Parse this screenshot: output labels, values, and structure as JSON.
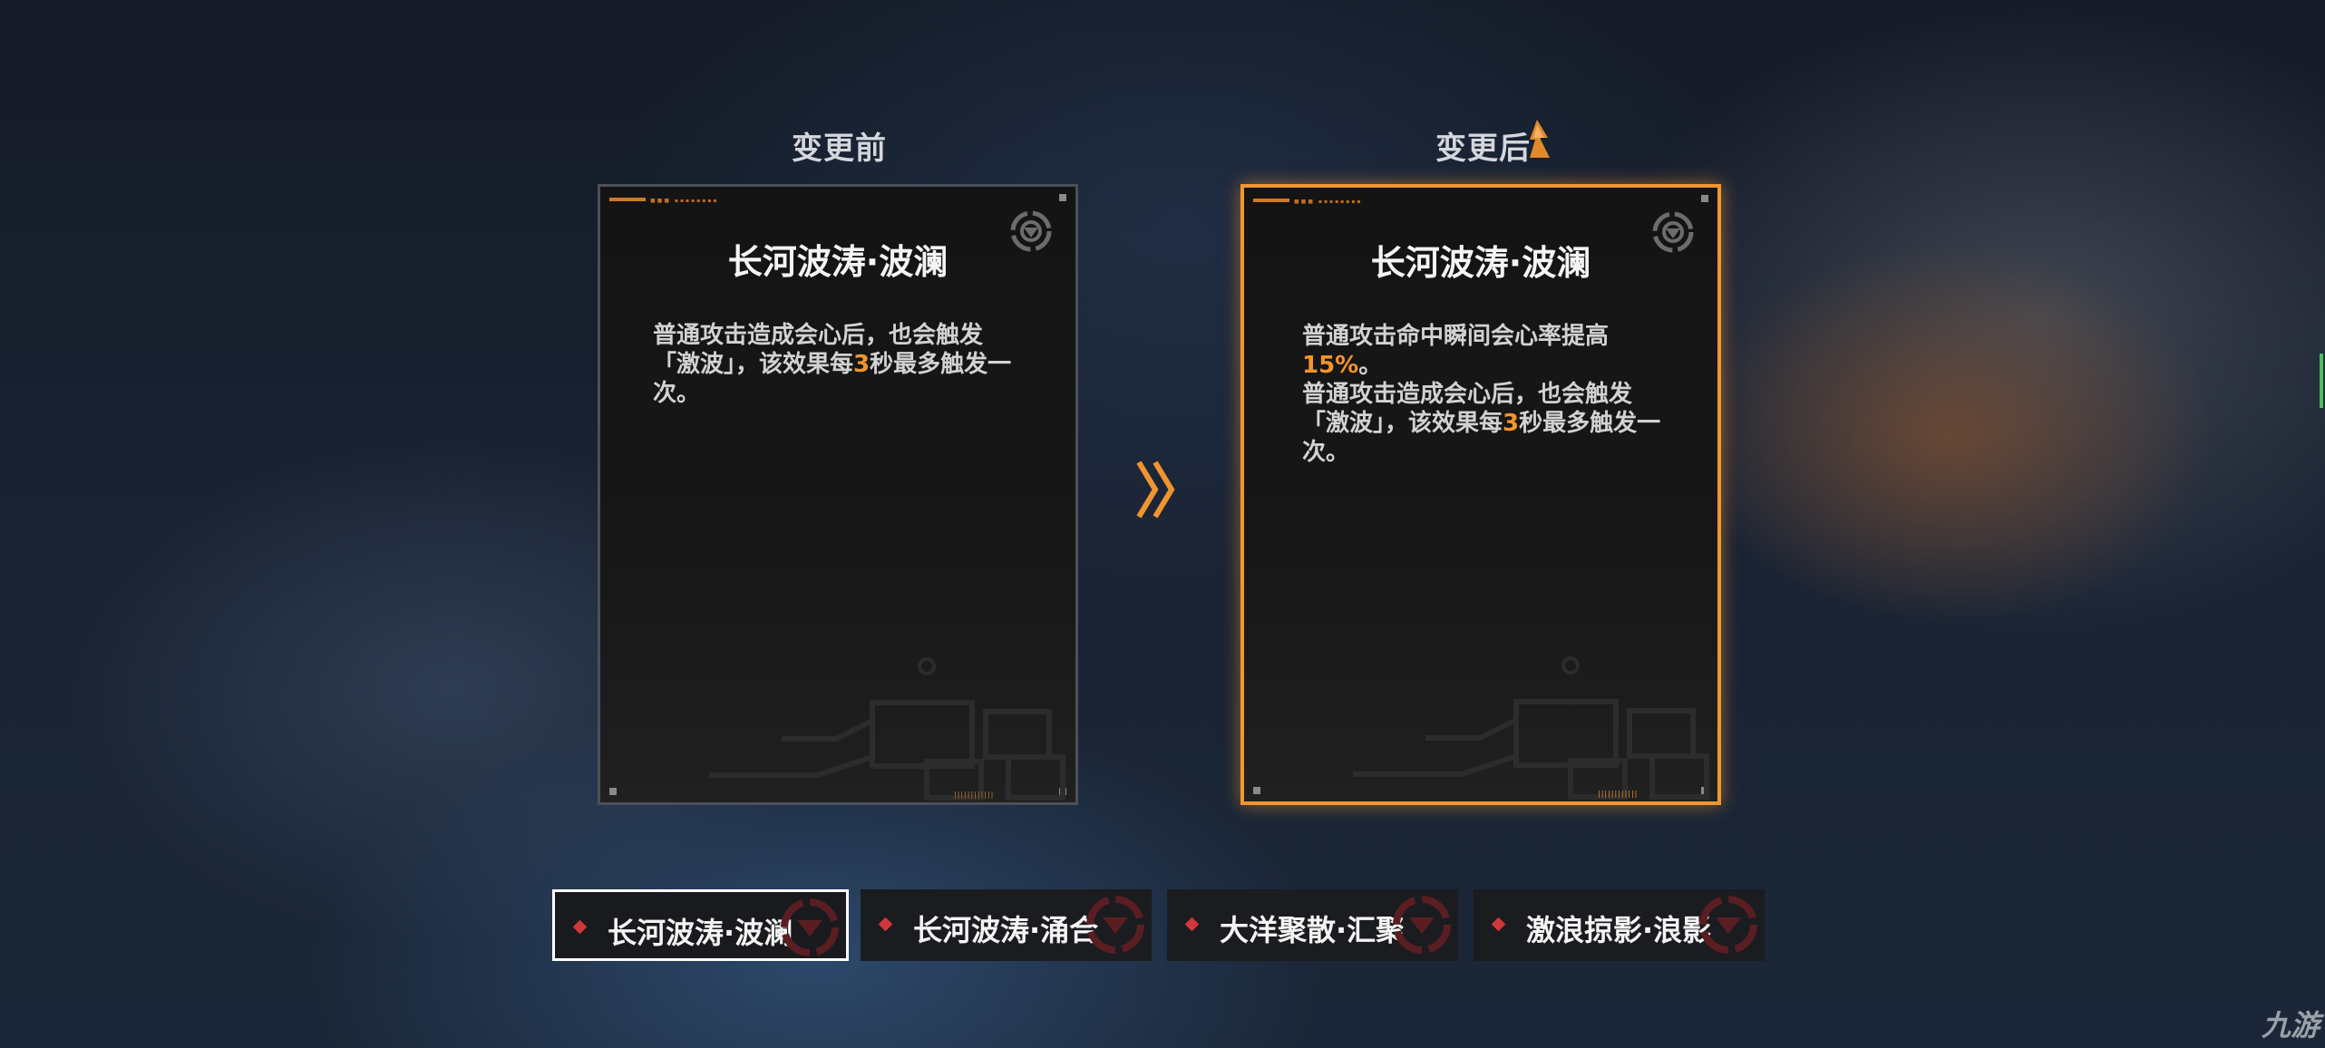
{
  "compare": {
    "before_label": "变更前",
    "after_label": "变更后"
  },
  "cards": {
    "before": {
      "title": "长河波涛·波澜",
      "desc_1": "普通攻击造成会心后，也会触发「激波」，该效果每",
      "desc_num": "3",
      "desc_2": "秒最多触发一次。"
    },
    "after": {
      "title": "长河波涛·波澜",
      "desc_a1": "普通攻击命中瞬间会心率提高",
      "desc_a_num": "15%",
      "desc_a2": "。",
      "desc_b1": "普通攻击造成会心后，也会触发「激波」，该效果每",
      "desc_b_num": "3",
      "desc_b2": "秒最多触发一次。"
    }
  },
  "tabs": [
    {
      "label": "长河波涛·波澜",
      "active": true
    },
    {
      "label": "长河波涛·涌合",
      "active": false
    },
    {
      "label": "大洋聚散·汇聚",
      "active": false
    },
    {
      "label": "激浪掠影·浪影",
      "active": false
    }
  ],
  "icons": {
    "arrow": "double-chevron-right-icon",
    "emblem": "emblem-icon",
    "upgrade": "upgrade-arrow-icon",
    "tab_marker": "diamond-icon"
  },
  "colors": {
    "accent": "#f2962e",
    "highlight_number": "#f3952b",
    "tab_marker": "#d0383a"
  },
  "watermark": "九游"
}
